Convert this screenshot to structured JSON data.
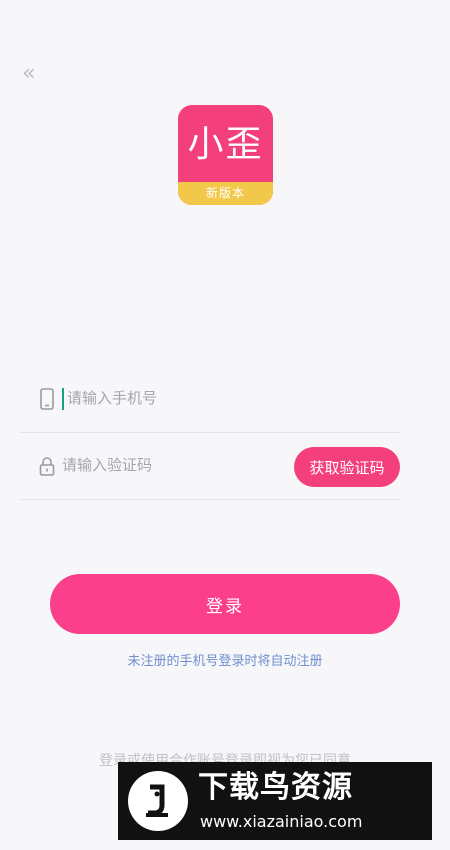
{
  "app": {
    "logo_title": "小歪",
    "logo_badge": "新版本"
  },
  "form": {
    "phone_placeholder": "请输入手机号",
    "code_placeholder": "请输入验证码",
    "get_code_label": "获取验证码",
    "login_label": "登录",
    "hint": "未注册的手机号登录时将自动注册"
  },
  "agreement": "登录或使用合作账号登录即视为您已同意",
  "watermark": {
    "title": "下载鸟资源",
    "url": "www.xiazainiao.com"
  },
  "colors": {
    "accent": "#fb3f8b",
    "logo_band": "#f2c84b",
    "link": "#6f8fd0"
  },
  "icons": {
    "back": "back-chevron-icon",
    "phone": "phone-icon",
    "lock": "lock-icon"
  }
}
